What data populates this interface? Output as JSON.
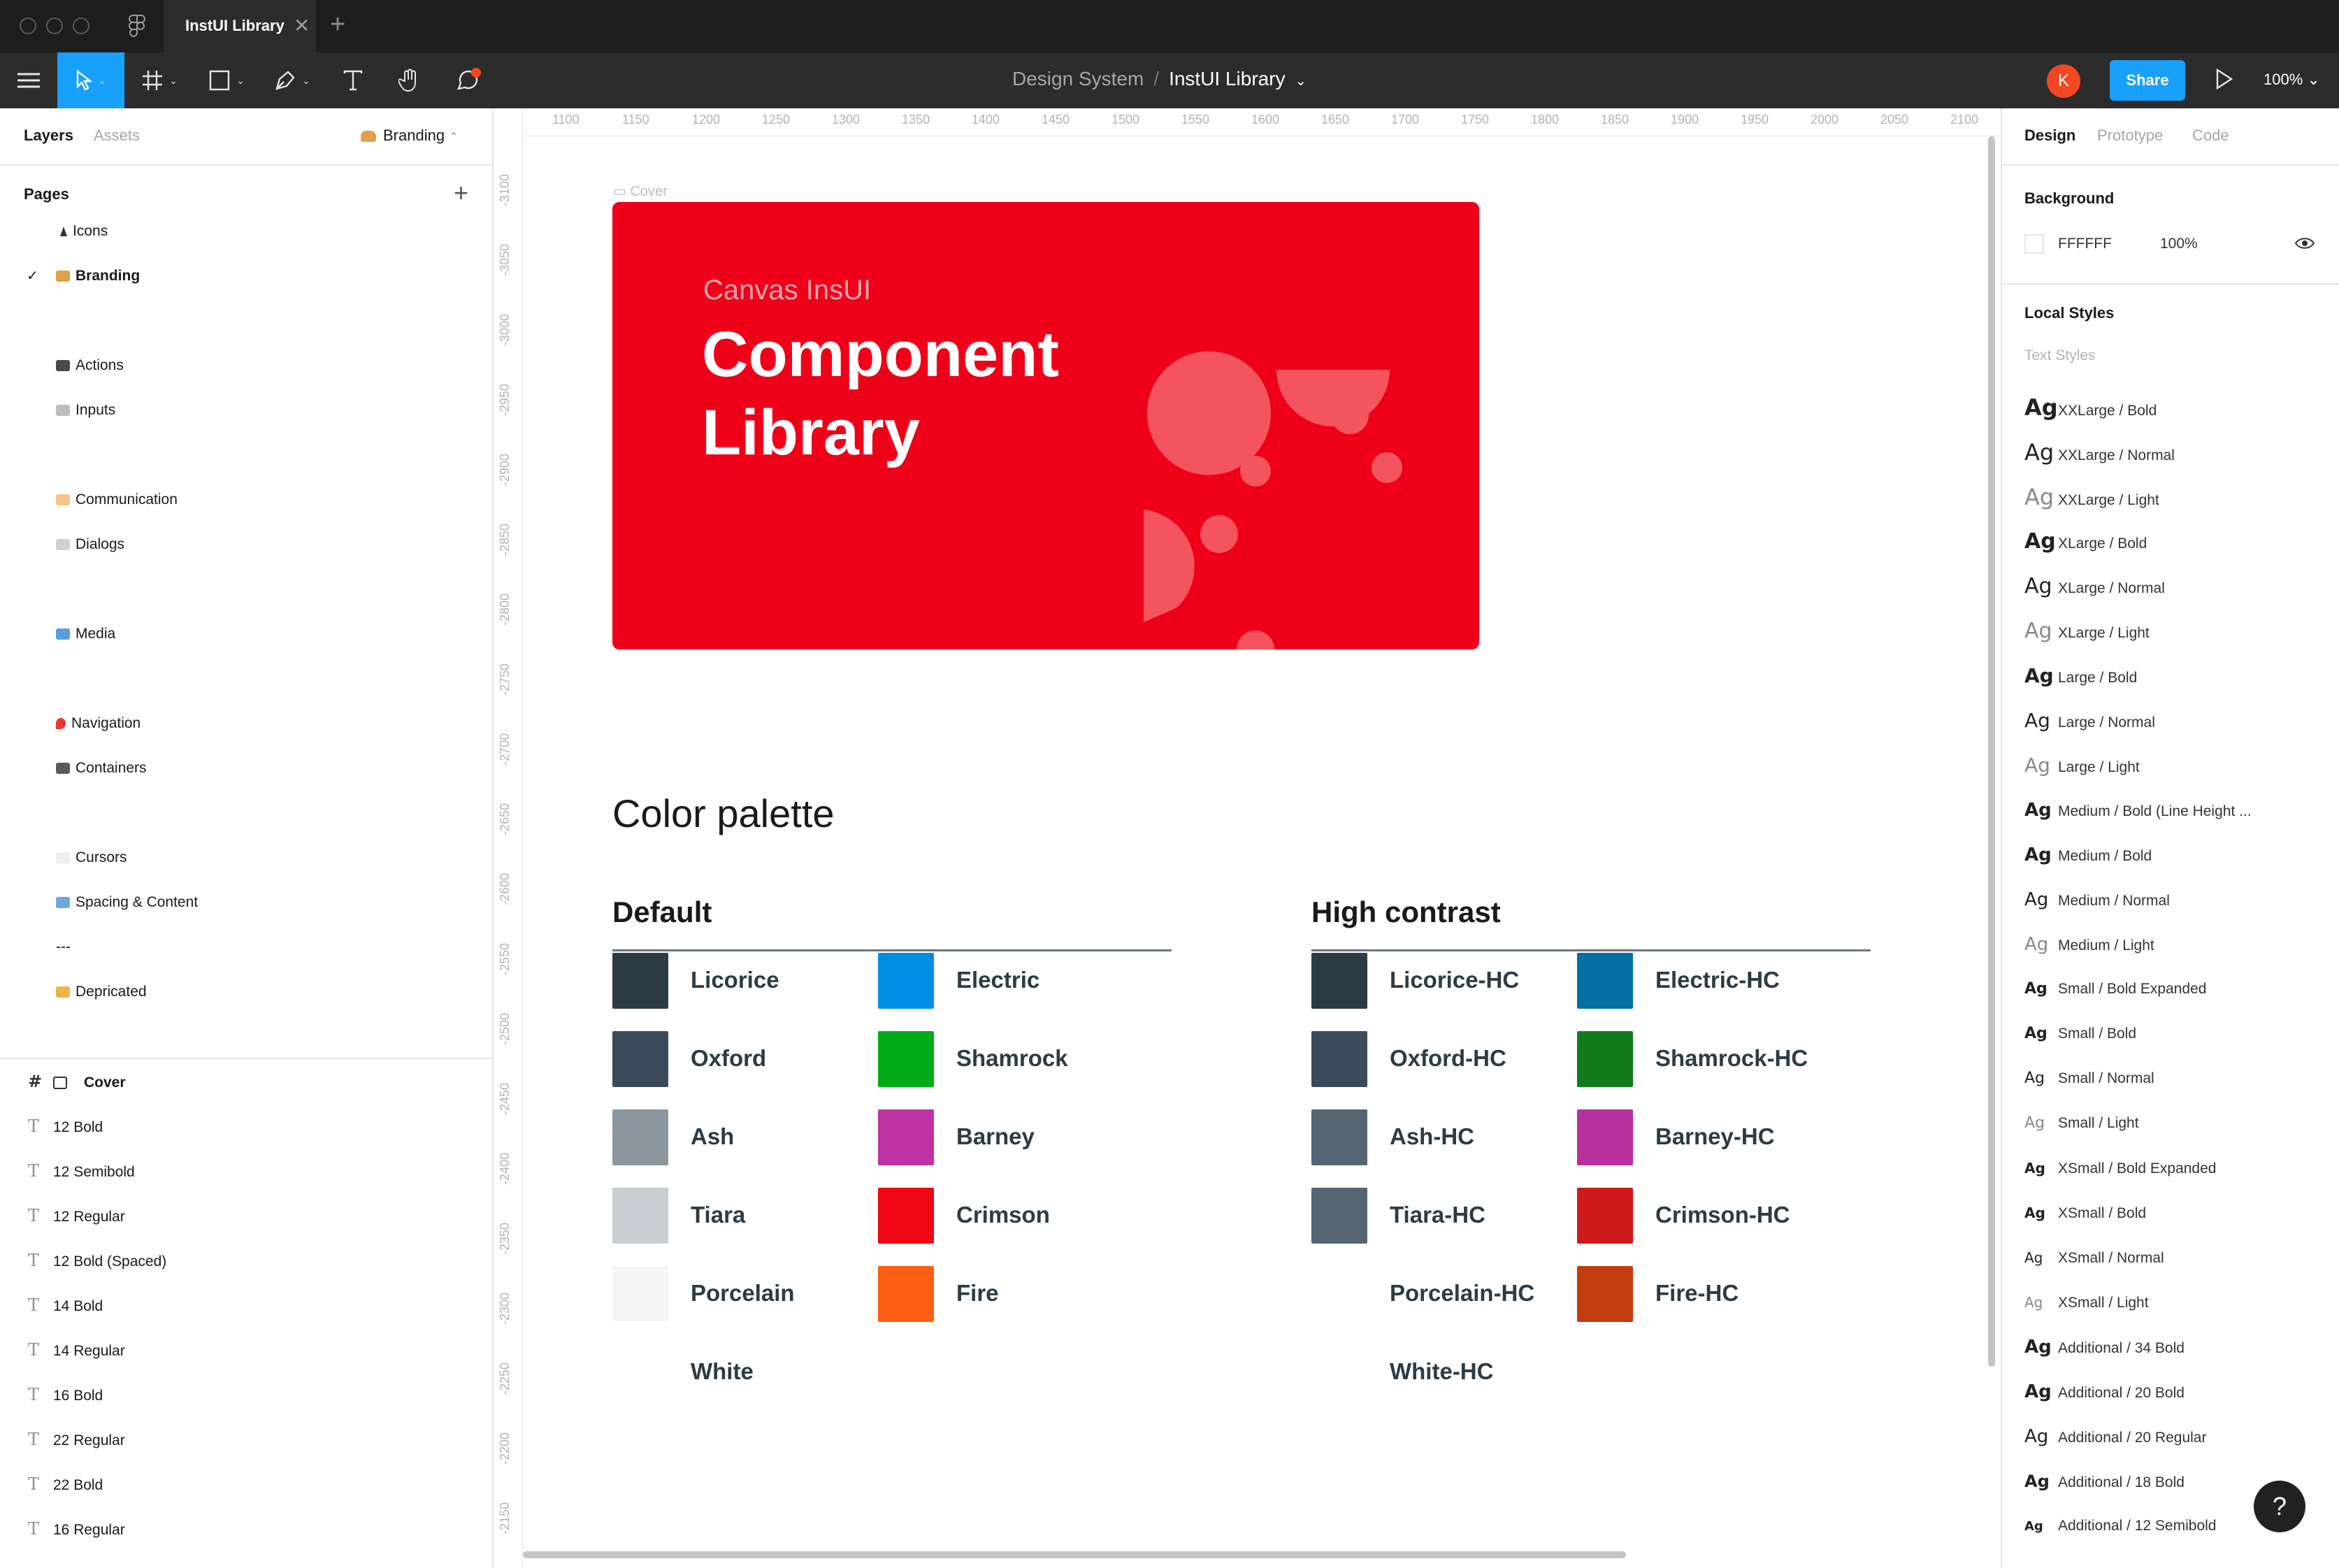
{
  "window": {
    "tab_title": "InstUI Library",
    "tab_close": "✕",
    "new_tab": "+"
  },
  "toolbar": {
    "breadcrumb_project": "Design System",
    "breadcrumb_sep": "/",
    "breadcrumb_file": "InstUI Library",
    "file_caret": "⌄",
    "avatar_initial": "K",
    "share_label": "Share",
    "zoom": "100%",
    "zoom_caret": "⌄"
  },
  "left_panel": {
    "tabs": [
      "Layers",
      "Assets"
    ],
    "current_page": "Branding",
    "pages_title": "Pages",
    "add_page": "+",
    "pages": [
      {
        "label": "Icons",
        "icon": "triangle-icon",
        "color": "#333333"
      },
      {
        "label": "Branding",
        "icon": "palette-icon",
        "color": "#e0a14a",
        "checked": true
      },
      {
        "label": "Actions",
        "icon": "grid-icon",
        "color": "#4a4a4a"
      },
      {
        "label": "Inputs",
        "icon": "keyboard-icon",
        "color": "#bdbdbd"
      },
      {
        "label": "Communication",
        "icon": "bandage-icon",
        "color": "#f7c48a"
      },
      {
        "label": "Dialogs",
        "icon": "speech-bubble-icon",
        "color": "#cfcfcf"
      },
      {
        "label": "Media",
        "icon": "picture-icon",
        "color": "#5aa0d8"
      },
      {
        "label": "Navigation",
        "icon": "pin-icon",
        "color": "#e53935"
      },
      {
        "label": "Containers",
        "icon": "cabinet-icon",
        "color": "#5a5a5a"
      },
      {
        "label": "Cursors",
        "icon": "pointer-icon",
        "color": "#eeeeee"
      },
      {
        "label": "Spacing & Content",
        "icon": "ruler-icon",
        "color": "#6fa8dc"
      },
      {
        "label": "---",
        "icon": "",
        "color": ""
      },
      {
        "label": "Depricated",
        "icon": "construction-icon",
        "color": "#f0b24a"
      }
    ],
    "layers": [
      {
        "label": "Cover",
        "kind": "frame"
      },
      {
        "label": "12 Bold",
        "kind": "text"
      },
      {
        "label": "12 Semibold",
        "kind": "text"
      },
      {
        "label": "12 Regular",
        "kind": "text"
      },
      {
        "label": "12 Bold (Spaced)",
        "kind": "text"
      },
      {
        "label": "14 Bold",
        "kind": "text"
      },
      {
        "label": "14 Regular",
        "kind": "text"
      },
      {
        "label": "16 Bold",
        "kind": "text"
      },
      {
        "label": "22 Regular",
        "kind": "text"
      },
      {
        "label": "22 Bold",
        "kind": "text"
      },
      {
        "label": "16 Regular",
        "kind": "text"
      }
    ]
  },
  "ruler": {
    "top": [
      "1100",
      "1150",
      "1200",
      "1250",
      "1300",
      "1350",
      "1400",
      "1450",
      "1500",
      "1550",
      "1600",
      "1650",
      "1700",
      "1750",
      "1800",
      "1850",
      "1900",
      "1950",
      "2000",
      "2050",
      "2100"
    ],
    "left": [
      "-3100",
      "-3050",
      "-3000",
      "-2950",
      "-2900",
      "-2850",
      "-2800",
      "-2750",
      "-2700",
      "-2650",
      "-2600",
      "-2550",
      "-2500",
      "-2450",
      "-2400",
      "-2350",
      "-2300",
      "-2250",
      "-2200",
      "-2150"
    ]
  },
  "canvas": {
    "frame_label": "Cover",
    "cover": {
      "subtitle": "Canvas InsUI",
      "title_line1": "Component",
      "title_line2": "Library",
      "color": "#EE0119"
    },
    "palette_title": "Color palette",
    "groups": [
      {
        "title": "Default",
        "columns": [
          [
            {
              "name": "Licorice",
              "color": "#2D3B45"
            },
            {
              "name": "Oxford",
              "color": "#394B58"
            },
            {
              "name": "Ash",
              "color": "#8B969E"
            },
            {
              "name": "Tiara",
              "color": "#C7CDD1"
            },
            {
              "name": "Porcelain",
              "color": "#F5F5F5"
            },
            {
              "name": "White",
              "color": "#FFFFFF"
            }
          ],
          [
            {
              "name": "Electric",
              "color": "#008EE2"
            },
            {
              "name": "Shamrock",
              "color": "#00AC18"
            },
            {
              "name": "Barney",
              "color": "#BF32A4"
            },
            {
              "name": "Crimson",
              "color": "#EE0612"
            },
            {
              "name": "Fire",
              "color": "#FC5E13"
            }
          ]
        ]
      },
      {
        "title": "High contrast",
        "columns": [
          [
            {
              "name": "Licorice-HC",
              "color": "#2D3B45"
            },
            {
              "name": "Oxford-HC",
              "color": "#394B58"
            },
            {
              "name": "Ash-HC",
              "color": "#556572"
            },
            {
              "name": "Tiara-HC",
              "color": "#556572"
            },
            {
              "name": "Porcelain-HC",
              "color": "#FFFFFF"
            },
            {
              "name": "White-HC",
              "color": "#FFFFFF"
            }
          ],
          [
            {
              "name": "Electric-HC",
              "color": "#0770A3"
            },
            {
              "name": "Shamrock-HC",
              "color": "#127A1B"
            },
            {
              "name": "Barney-HC",
              "color": "#B8309E"
            },
            {
              "name": "Crimson-HC",
              "color": "#D01A19"
            },
            {
              "name": "Fire-HC",
              "color": "#C23C0D"
            }
          ]
        ]
      }
    ]
  },
  "right_panel": {
    "tabs": [
      "Design",
      "Prototype",
      "Code"
    ],
    "background_title": "Background",
    "background_hex": "FFFFFF",
    "background_opacity": "100%",
    "local_styles_title": "Local Styles",
    "text_styles_title": "Text Styles",
    "ag_glyph": "Ag",
    "text_styles": [
      {
        "label": "XXLarge / Bold",
        "weight": "bold"
      },
      {
        "label": "XXLarge / Normal",
        "weight": "normal"
      },
      {
        "label": "XXLarge / Light",
        "weight": "light"
      },
      {
        "label": "XLarge / Bold",
        "weight": "bold"
      },
      {
        "label": "XLarge / Normal",
        "weight": "normal"
      },
      {
        "label": "XLarge / Light",
        "weight": "light"
      },
      {
        "label": "Large / Bold",
        "weight": "bold"
      },
      {
        "label": "Large / Normal",
        "weight": "normal"
      },
      {
        "label": "Large / Light",
        "weight": "light"
      },
      {
        "label": "Medium / Bold (Line Height ...",
        "weight": "bold"
      },
      {
        "label": "Medium / Bold",
        "weight": "bold"
      },
      {
        "label": "Medium / Normal",
        "weight": "normal"
      },
      {
        "label": "Medium / Light",
        "weight": "light"
      },
      {
        "label": "Small / Bold Expanded",
        "weight": "bold"
      },
      {
        "label": "Small / Bold",
        "weight": "bold"
      },
      {
        "label": "Small / Normal",
        "weight": "normal"
      },
      {
        "label": "Small / Light",
        "weight": "light"
      },
      {
        "label": "XSmall / Bold Expanded",
        "weight": "bold"
      },
      {
        "label": "XSmall / Bold",
        "weight": "bold"
      },
      {
        "label": "XSmall / Normal",
        "weight": "normal"
      },
      {
        "label": "XSmall / Light",
        "weight": "light"
      },
      {
        "label": "Additional / 34 Bold",
        "weight": "bold"
      },
      {
        "label": "Additional / 20 Bold",
        "weight": "bold"
      },
      {
        "label": "Additional / 20 Regular",
        "weight": "normal"
      },
      {
        "label": "Additional / 18 Bold",
        "weight": "bold"
      },
      {
        "label": "Additional / 12 Semibold",
        "weight": "bold"
      }
    ],
    "help_label": "?"
  }
}
